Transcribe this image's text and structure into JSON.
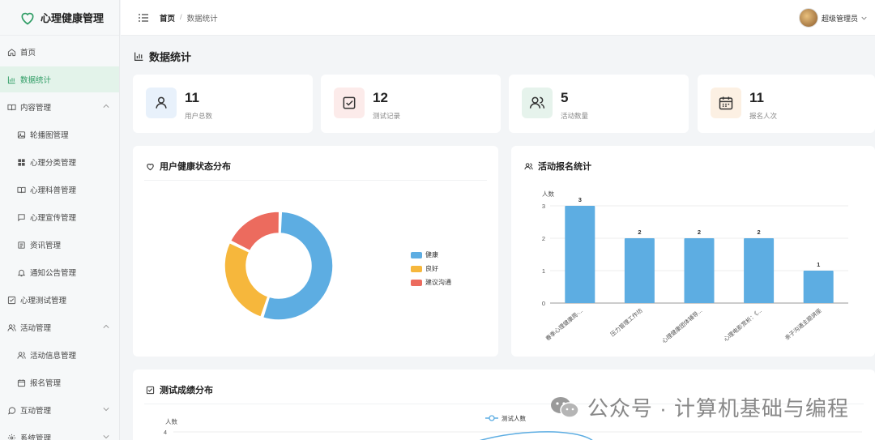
{
  "app": {
    "title": "心理健康管理"
  },
  "sidebar": {
    "items": [
      {
        "label": "首页",
        "icon": "home-icon"
      },
      {
        "label": "数据统计",
        "icon": "bar-chart-icon",
        "active": true
      },
      {
        "label": "内容管理",
        "icon": "book-icon",
        "expanded": true
      },
      {
        "label": "轮播图管理",
        "icon": "image-icon"
      },
      {
        "label": "心理分类管理",
        "icon": "grid-icon"
      },
      {
        "label": "心理科普管理",
        "icon": "book-open-icon"
      },
      {
        "label": "心理宣传管理",
        "icon": "message-icon"
      },
      {
        "label": "资讯管理",
        "icon": "newspaper-icon"
      },
      {
        "label": "通知公告管理",
        "icon": "bell-icon"
      },
      {
        "label": "心理测试管理",
        "icon": "checkbox-icon"
      },
      {
        "label": "活动管理",
        "icon": "users-icon",
        "expanded": true
      },
      {
        "label": "活动信息管理",
        "icon": "users-icon"
      },
      {
        "label": "报名管理",
        "icon": "calendar-icon"
      },
      {
        "label": "互动管理",
        "icon": "chat-icon",
        "expanded": false
      },
      {
        "label": "系统管理",
        "icon": "gear-icon",
        "expanded": false
      }
    ]
  },
  "header": {
    "breadcrumb_home": "首页",
    "breadcrumb_sep": "/",
    "breadcrumb_current": "数据统计",
    "user_name": "超级管理员"
  },
  "page": {
    "title": "数据统计"
  },
  "stats": [
    {
      "value": "11",
      "label": "用户总数",
      "icon": "user-icon",
      "color": "#4a90d9",
      "bg": "#e8f1fb"
    },
    {
      "value": "12",
      "label": "测试记录",
      "icon": "checkbox-icon",
      "color": "#e0574f",
      "bg": "#fcebea"
    },
    {
      "value": "5",
      "label": "活动数量",
      "icon": "users-icon",
      "color": "#3d8f6a",
      "bg": "#e6f3ec"
    },
    {
      "value": "11",
      "label": "报名人次",
      "icon": "calendar-icon",
      "color": "#d9822b",
      "bg": "#fcf0e3"
    }
  ],
  "panels": {
    "health": {
      "title": "用户健康状态分布"
    },
    "signup": {
      "title": "活动报名统计"
    },
    "scores": {
      "title": "测试成绩分布"
    }
  },
  "watermark": {
    "text": "公众号 · 计算机基础与编程"
  },
  "chart_data": [
    {
      "type": "pie",
      "title": "用户健康状态分布",
      "donut": true,
      "legend_position": "right",
      "categories": [
        "健康",
        "良好",
        "建议沟通"
      ],
      "values": [
        6,
        3,
        2
      ],
      "colors": [
        "#5dade2",
        "#f6b73c",
        "#ec6b5e"
      ]
    },
    {
      "type": "bar",
      "title": "活动报名统计",
      "ylabel": "人数",
      "ylim": [
        0,
        3
      ],
      "yticks": [
        0,
        1,
        2,
        3
      ],
      "categories": [
        "春季心理健康周-...",
        "压力管理工作坊",
        "心理健康团体辅导...",
        "心理电影赏析：《...",
        "亲子沟通主题讲座"
      ],
      "values": [
        3,
        2,
        2,
        2,
        1
      ],
      "color": "#5dade2",
      "grid": true
    },
    {
      "type": "line",
      "title": "测试成绩分布",
      "ylabel": "人数",
      "yticks_visible": [
        4
      ],
      "series": [
        {
          "name": "测试人数"
        }
      ],
      "color": "#5dade2"
    }
  ]
}
